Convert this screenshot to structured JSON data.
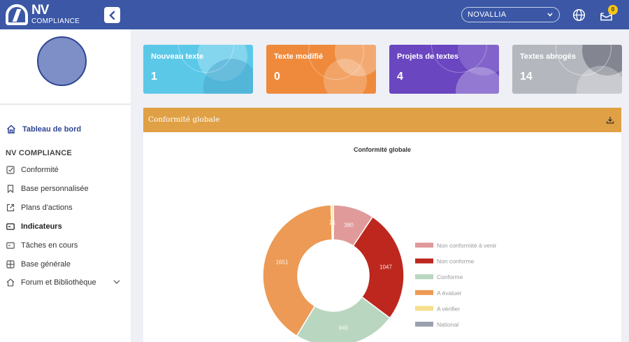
{
  "brand": {
    "name": "NV",
    "subtitle": "COMPLIANCE"
  },
  "header": {
    "org_selected": "NOVALLIA",
    "mail_count": "0"
  },
  "sidebar": {
    "dashboard": "Tableau de bord",
    "section": "NV COMPLIANCE",
    "items": [
      {
        "label": "Conformité",
        "icon": "checkbox-icon"
      },
      {
        "label": "Base personnalisée",
        "icon": "bookmark-icon"
      },
      {
        "label": "Plans d'actions",
        "icon": "external-link-icon"
      },
      {
        "label": "Indicateurs",
        "icon": "card-icon",
        "active": true
      },
      {
        "label": "Tâches en cours",
        "icon": "card-icon"
      },
      {
        "label": "Base générale",
        "icon": "grid-icon"
      },
      {
        "label": "Forum et Bibliothèque",
        "icon": "home-icon"
      }
    ]
  },
  "cards": [
    {
      "title": "Nouveau texte",
      "count": "1",
      "color": "#5bc8e8"
    },
    {
      "title": "Texte modifié",
      "count": "0",
      "color": "#ef8a3c"
    },
    {
      "title": "Projets de textes",
      "count": "4",
      "color": "#6b46c1"
    },
    {
      "title": "Textes abrogés",
      "count": "14",
      "color": "#b4b7be"
    }
  ],
  "panel": {
    "title": "Conformité globale"
  },
  "chart_data": {
    "type": "donut",
    "title": "Conformité globale",
    "legend_position": "right",
    "series": [
      {
        "name": "Non conformité à venir",
        "value": 380,
        "color": "#e09a9a"
      },
      {
        "name": "Non conforme",
        "value": 1047,
        "color": "#bd271e"
      },
      {
        "name": "Conforme",
        "value": 949,
        "color": "#b9d6c0"
      },
      {
        "name": "A évaluer",
        "value": 1651,
        "color": "#ec9a55"
      },
      {
        "name": "A vérifier",
        "value": 21,
        "color": "#f6df8e"
      },
      {
        "name": "National",
        "value": 0,
        "color": "#9aa0ae"
      }
    ]
  }
}
